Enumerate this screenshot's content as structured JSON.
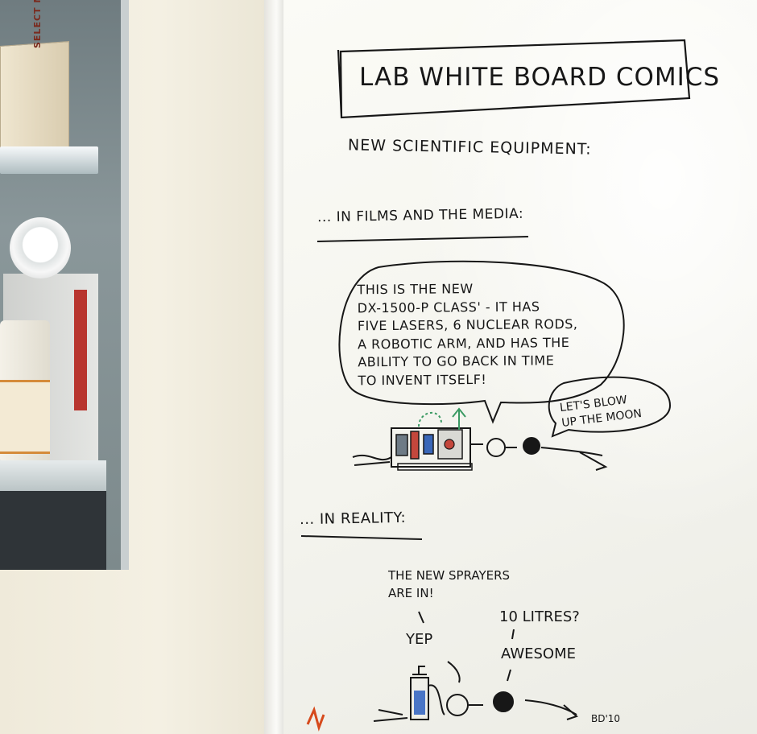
{
  "board": {
    "title": "LAB WHITE BOARD COMICS",
    "subtitle": "NEW SCIENTIFIC EQUIPMENT:",
    "section_films": "... IN FILMS AND THE MEDIA:",
    "speech_main": "THIS IS THE NEW\nDX-1500-P CLASS' - IT HAS\nFIVE LASERS, 6 NUCLEAR RODS,\nA ROBOTIC ARM, AND HAS THE\nABILITY TO GO BACK IN TIME\nTO INVENT ITSELF!",
    "speech_moon": "LET'S BLOW\nUP THE MOON",
    "section_reality": "... IN REALITY:",
    "sprayer_quote": "THE NEW SPRAYERS\nARE IN!",
    "yep": "YEP",
    "litres": "10 LITRES?",
    "awesome": "AWESOME",
    "signature": "BD'10"
  },
  "cabinet": {
    "box_label": "SELECT MICRO SLIDES"
  },
  "colors": {
    "ink": "#171717",
    "accent_red": "#d64a1c",
    "accent_blue": "#2c5fbf",
    "accent_green": "#3b9a63"
  }
}
